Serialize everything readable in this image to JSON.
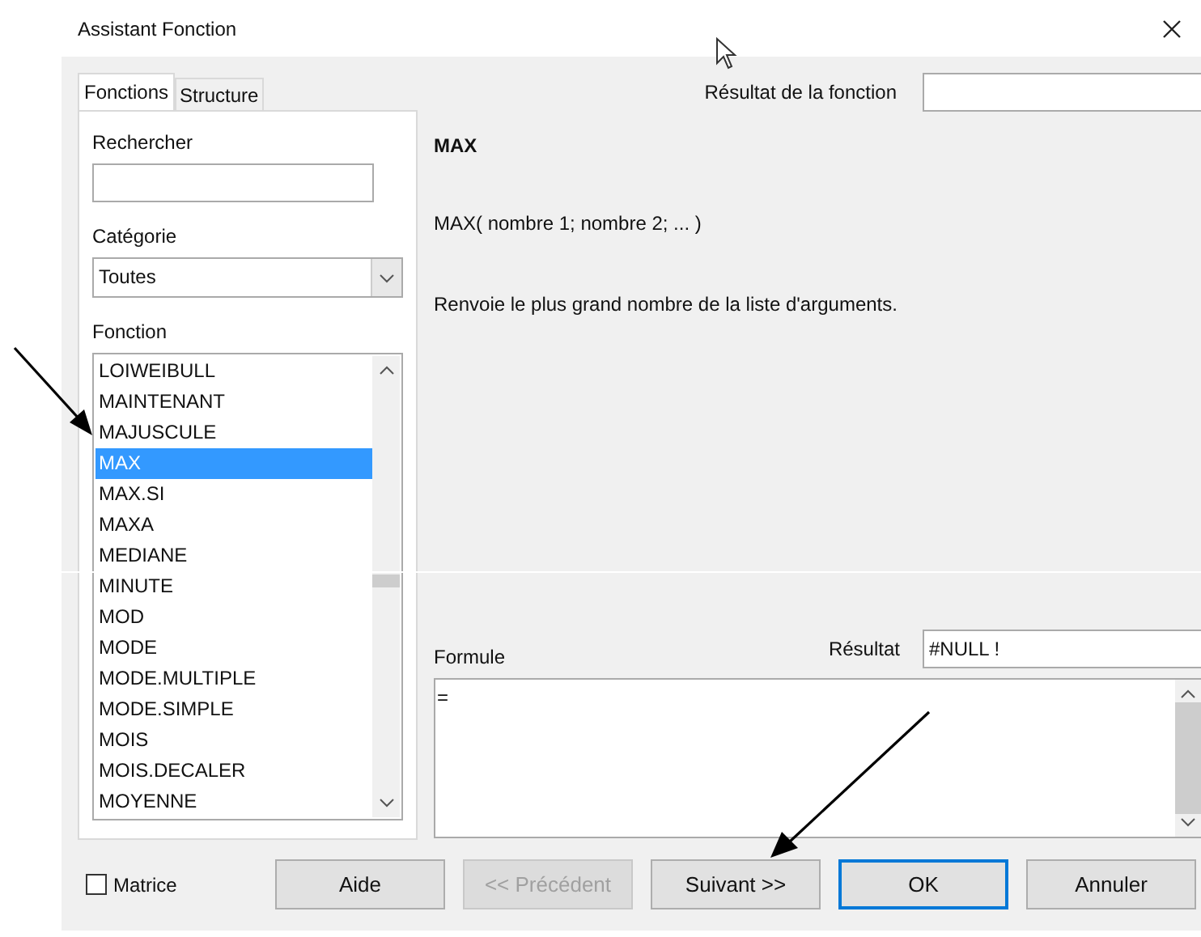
{
  "window": {
    "title": "Assistant Fonction"
  },
  "tabs": [
    {
      "label": "Fonctions",
      "selected": true
    },
    {
      "label": "Structure",
      "selected": false
    }
  ],
  "search": {
    "label": "Rechercher"
  },
  "category": {
    "label": "Catégorie",
    "value": "Toutes"
  },
  "functions": {
    "label": "Fonction",
    "items": [
      {
        "name": "LOIWEIBULL",
        "selected": false
      },
      {
        "name": "MAINTENANT",
        "selected": false
      },
      {
        "name": "MAJUSCULE",
        "selected": false
      },
      {
        "name": "MAX",
        "selected": true
      },
      {
        "name": "MAX.SI",
        "selected": false
      },
      {
        "name": "MAXA",
        "selected": false
      },
      {
        "name": "MEDIANE",
        "selected": false
      },
      {
        "name": "MINUTE",
        "selected": false
      },
      {
        "name": "MOD",
        "selected": false
      },
      {
        "name": "MODE",
        "selected": false
      },
      {
        "name": "MODE.MULTIPLE",
        "selected": false
      },
      {
        "name": "MODE.SIMPLE",
        "selected": false
      },
      {
        "name": "MOIS",
        "selected": false
      },
      {
        "name": "MOIS.DECALER",
        "selected": false
      },
      {
        "name": "MOYENNE",
        "selected": false
      }
    ]
  },
  "function_result": {
    "label": "Résultat de la fonction"
  },
  "function_name": "MAX",
  "syntax": "MAX( nombre 1; nombre 2; ...  )",
  "description": "Renvoie le plus grand nombre de la liste d'arguments.",
  "formula": {
    "label": "Formule",
    "value": "="
  },
  "result": {
    "label": "Résultat",
    "value": "#NULL !"
  },
  "matrix": {
    "label": "Matrice",
    "checked": false
  },
  "buttons": [
    {
      "label": "Aide",
      "disabled": false,
      "default": false
    },
    {
      "label": "<< Précédent",
      "disabled": true,
      "default": false
    },
    {
      "label": "Suivant >>",
      "disabled": false,
      "default": false
    },
    {
      "label": "OK",
      "disabled": false,
      "default": true
    },
    {
      "label": "Annuler",
      "disabled": false,
      "default": false
    }
  ]
}
